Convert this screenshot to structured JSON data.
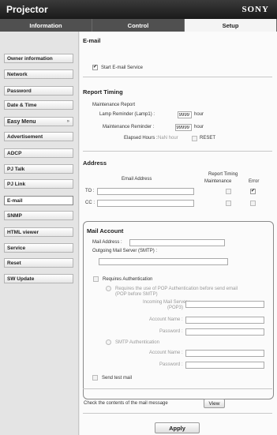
{
  "header": {
    "app_title": "Projector",
    "brand": "SONY"
  },
  "tabs": [
    {
      "label": "Information",
      "active": false
    },
    {
      "label": "Control",
      "active": false
    },
    {
      "label": "Setup",
      "active": true
    }
  ],
  "sidebar": {
    "items": [
      {
        "label": "Owner information"
      },
      {
        "label": "Network"
      },
      {
        "label": "Password"
      },
      {
        "label": "Date & Time"
      },
      {
        "label": "Easy Menu",
        "chevron": "»"
      },
      {
        "label": "Advertisement"
      },
      {
        "label": "ADCP"
      },
      {
        "label": "PJ Talk"
      },
      {
        "label": "PJ Link"
      },
      {
        "label": "E-mail"
      },
      {
        "label": "SNMP"
      },
      {
        "label": "HTML viewer"
      },
      {
        "label": "Service"
      },
      {
        "label": "Reset"
      },
      {
        "label": "SW Update"
      }
    ]
  },
  "email": {
    "title": "E-mail",
    "start_label": "Start E-mail Service",
    "start_checked": true
  },
  "timing": {
    "title": "Report Timing",
    "maint_report": "Maintenance Report",
    "lamp_label": "Lamp Reminder (Lamp1) :",
    "lamp_value": "9999",
    "lamp_unit": "hour",
    "maint_label": "Maintenance Reminder :",
    "maint_value": "99999",
    "maint_unit": "hour",
    "elapsed_label": "Elapsed Hours :",
    "elapsed_value": "NaN hour",
    "reset_label": "RESET"
  },
  "address": {
    "title": "Address",
    "col_email": "Email Address",
    "col_report": "Report Timing",
    "col_maint": "Maintenance",
    "col_error": "Error",
    "rows": [
      {
        "label": "TO :",
        "value": "",
        "maint": false,
        "error": true
      },
      {
        "label": "CC :",
        "value": "",
        "maint": false,
        "error": false
      }
    ]
  },
  "mail": {
    "title": "Mail Account",
    "address_label": "Mail Address :",
    "address_value": "",
    "smtp_label": "Outgoing Mail Server (SMTP) :",
    "smtp_value": "",
    "auth_label": "Requires Authentication",
    "pop_option_line1": "Requires the use of POP Authentication before send email",
    "pop_option_line2": "(POP before SMTP)",
    "incoming_line1": "Incoming Mail Server :",
    "incoming_line2": "(POP3)",
    "account_label": "Account Name :",
    "password_label": "Password :",
    "smtp_auth_label": "SMTP Authentication",
    "smtp_account_label": "Account Name :",
    "smtp_password_label": "Password :"
  },
  "test": {
    "label": "Send test mail"
  },
  "check": {
    "label": "Check the contents of the mail message",
    "button": "View"
  },
  "apply": {
    "label": "Apply"
  }
}
